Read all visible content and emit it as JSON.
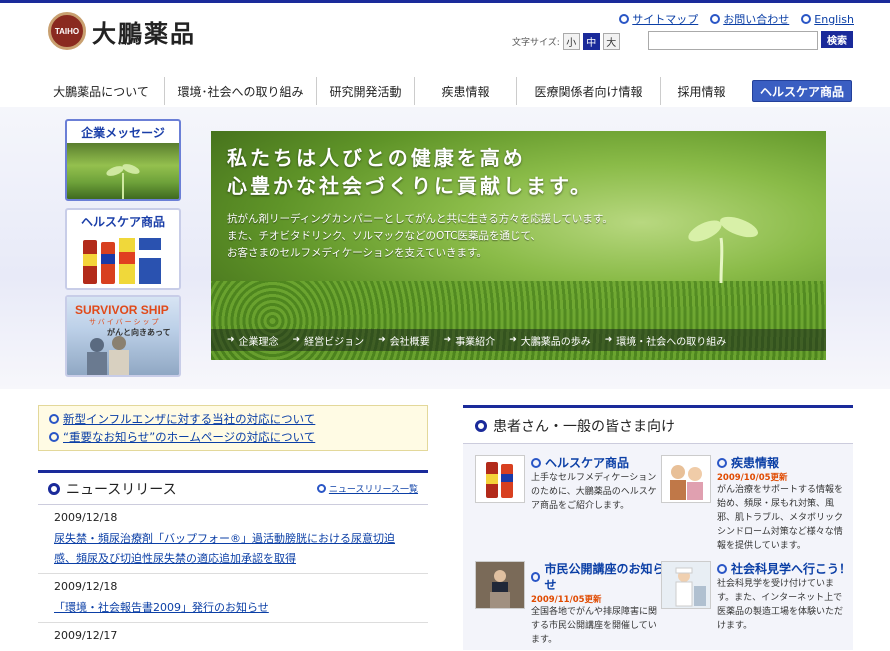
{
  "header": {
    "logo_mark": "TAIHO",
    "logo_text": "大鵬薬品",
    "util_links": [
      "サイトマップ",
      "お問い合わせ",
      "English"
    ],
    "fontsize_label": "文字サイズ:",
    "fontsize_options": [
      "小",
      "中",
      "大"
    ],
    "search_placeholder": "",
    "search_button": "検索"
  },
  "gnav": [
    "大鵬薬品について",
    "環境･社会への取り組み",
    "研究開発活動",
    "疾患情報",
    "医療関係者向け情報",
    "採用情報",
    "ヘルスケア商品"
  ],
  "side_cards": {
    "corporate": "企業メッセージ",
    "healthcare": "ヘルスケア商品",
    "survivor_title": "SURVIVOR SHIP",
    "survivor_kana": "サバイバーシップ",
    "survivor_sub": "がんと向きあって"
  },
  "hero": {
    "headline_1": "私たちは人びとの健康を高め",
    "headline_2": "心豊かな社会づくりに貢献します。",
    "body_1": "抗がん剤リーディングカンパニーとしてがんと共に生きる方々を応援しています。",
    "body_2": "また、チオビタドリンク、ソルマックなどのOTC医薬品を通じて、",
    "body_3": "お客さまのセルフメディケーションを支えていきます。",
    "links": [
      "企業理念",
      "経営ビジョン",
      "会社概要",
      "事業紹介",
      "大鵬薬品の歩み",
      "環境・社会への取り組み"
    ]
  },
  "notice": [
    "新型インフルエンザに対する当社の対応について",
    "“重要なお知らせ”のホームページの対応について"
  ],
  "news": {
    "title": "ニュースリリース",
    "more": "ニュースリリース一覧",
    "items": [
      {
        "date": "2009/12/18",
        "title": "尿失禁・頻尿治療剤「バップフォー®」過活動膀胱における尿意切迫感、頻尿及び切迫性尿失禁の適応追加承認を取得"
      },
      {
        "date": "2009/12/18",
        "title": "「環境・社会報告書2009」発行のお知らせ"
      },
      {
        "date": "2009/12/17",
        "title": ""
      }
    ]
  },
  "patients": {
    "title": "患者さん・一般の皆さま向け",
    "items": [
      {
        "title": "ヘルスケア商品",
        "date": "",
        "desc": "上手なセルフメディケーションのために、大鵬薬品のヘルスケア商品をご紹介します。"
      },
      {
        "title": "疾患情報",
        "date": "2009/10/05更新",
        "desc": "がん治療をサポートする情報を始め、頻尿・尿もれ対策、風邪、肌トラブル、メタボリックシンドローム対策など様々な情報を提供しています。"
      },
      {
        "title": "市民公開講座のお知らせ",
        "date": "2009/11/05更新",
        "desc": "全国各地でがんや排尿障害に関する市民公開講座を開催しています。"
      },
      {
        "title": "社会科見学へ行こう！",
        "date": "",
        "desc": "社会科見学を受け付けています。また、インターネット上で医薬品の製造工場を体験いただけます。"
      }
    ]
  }
}
